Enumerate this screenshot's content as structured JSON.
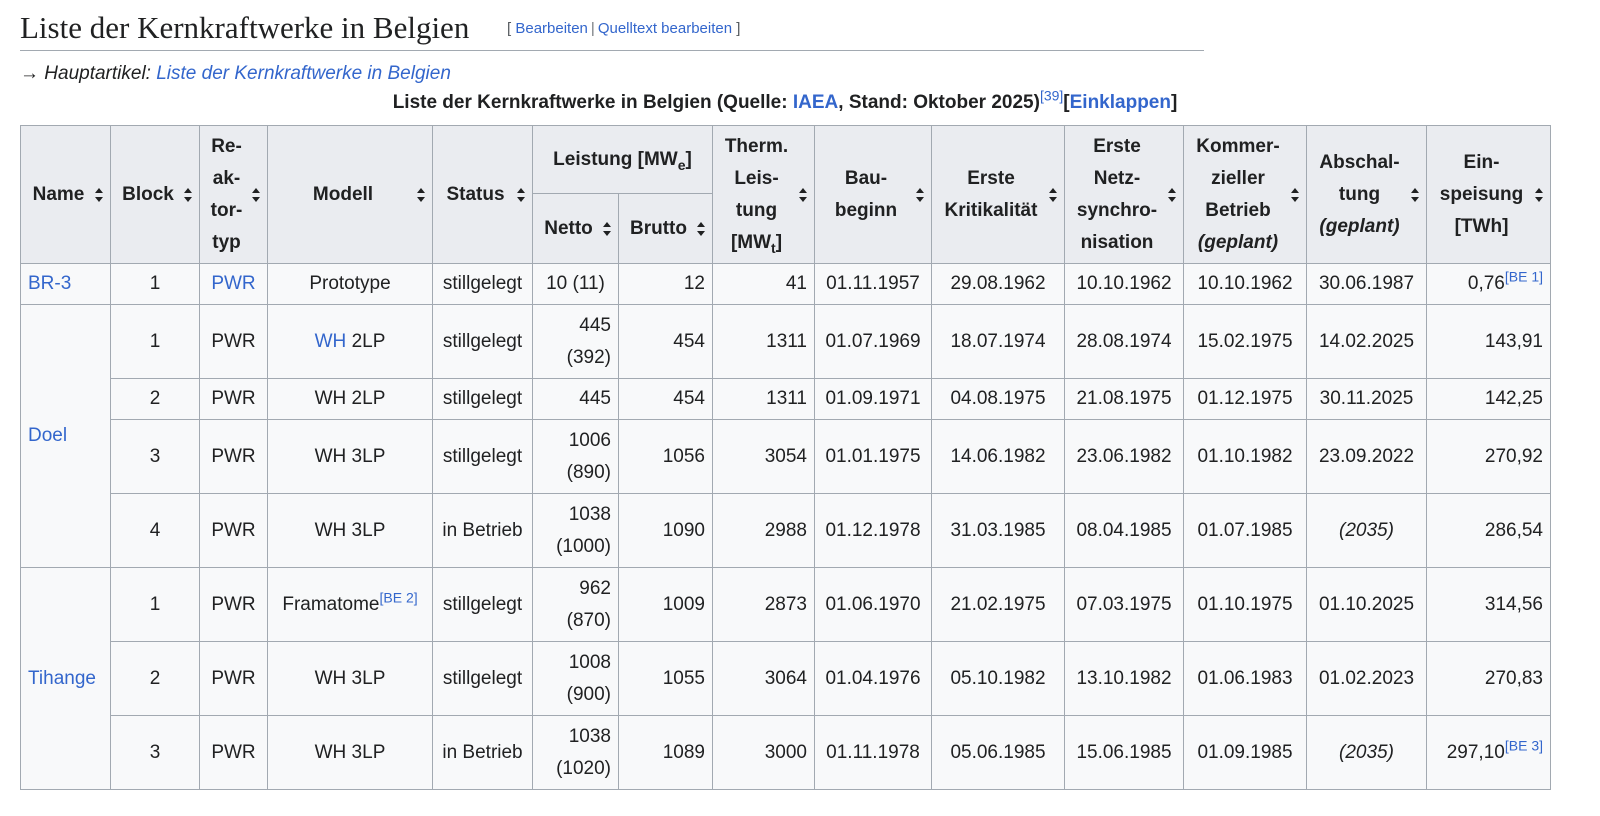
{
  "heading": {
    "title": "Liste der Kernkraftwerke in Belgien",
    "edit_open": "[",
    "edit": "Bearbeiten",
    "edit_sep": "|",
    "edit_source": "Quelltext bearbeiten",
    "edit_close": "]"
  },
  "hatnote": {
    "arrow": "→",
    "prefix": "Hauptartikel:",
    "link": "Liste der Kernkraftwerke in Belgien"
  },
  "caption": {
    "pre": "Liste der Kernkraftwerke in Belgien (Quelle: ",
    "link": "IAEA",
    "post": ", Stand: Oktober 2025)",
    "ref": "[39]",
    "collapse_open": "[",
    "collapse": "Einklappen",
    "collapse_close": "]"
  },
  "columns": {
    "name": "Name",
    "block": "Block",
    "reactor": "Re-ak-tor-typ",
    "model": "Modell",
    "status": "Status",
    "power_pre": "Leistung [MW",
    "power_sub": "e",
    "power_post": "]",
    "net": "Netto",
    "gross": "Brutto",
    "thermal_pre": "Therm. Leis-tung [MW",
    "thermal_sub": "t",
    "thermal_post": "]",
    "construction": "Bau-beginn",
    "criticality": "Erste Kritikalität",
    "grid": "Erste Netz-synchro-nisation",
    "commercial": "Kommer-zieller Betrieb",
    "commercial_note": "(geplant)",
    "shutdown": "Abschal-tung",
    "shutdown_note": "(geplant)",
    "feed": "Ein-speisung [TWh]"
  },
  "plants": {
    "br3": "BR-3",
    "doel": "Doel",
    "tihange": "Tihange"
  },
  "rows": [
    {
      "block": "1",
      "type": "PWR",
      "model": "Prototype",
      "status": "stillgelegt",
      "net": "10 (11)",
      "gross": "12",
      "thermal": "41",
      "construction": "01.11.1957",
      "criticality": "29.08.1962",
      "grid": "10.10.1962",
      "commercial": "10.10.1962",
      "shutdown": "30.06.1987",
      "feed": "0,76",
      "feed_ref": "[BE 1]"
    },
    {
      "block": "1",
      "type": "PWR",
      "model_link": "WH",
      "model": "2LP",
      "status": "stillgelegt",
      "net": "445 (392)",
      "gross": "454",
      "thermal": "1311",
      "construction": "01.07.1969",
      "criticality": "18.07.1974",
      "grid": "28.08.1974",
      "commercial": "15.02.1975",
      "shutdown": "14.02.2025",
      "feed": "143,91"
    },
    {
      "block": "2",
      "type": "PWR",
      "model": "WH 2LP",
      "status": "stillgelegt",
      "net": "445",
      "gross": "454",
      "thermal": "1311",
      "construction": "01.09.1971",
      "criticality": "04.08.1975",
      "grid": "21.08.1975",
      "commercial": "01.12.1975",
      "shutdown": "30.11.2025",
      "feed": "142,25"
    },
    {
      "block": "3",
      "type": "PWR",
      "model": "WH 3LP",
      "status": "stillgelegt",
      "net": "1006 (890)",
      "gross": "1056",
      "thermal": "3054",
      "construction": "01.01.1975",
      "criticality": "14.06.1982",
      "grid": "23.06.1982",
      "commercial": "01.10.1982",
      "shutdown": "23.09.2022",
      "feed": "270,92"
    },
    {
      "block": "4",
      "type": "PWR",
      "model": "WH 3LP",
      "status": "in Betrieb",
      "net": "1038 (1000)",
      "gross": "1090",
      "thermal": "2988",
      "construction": "01.12.1978",
      "criticality": "31.03.1985",
      "grid": "08.04.1985",
      "commercial": "01.07.1985",
      "shutdown": "(2035)",
      "feed": "286,54"
    },
    {
      "block": "1",
      "type": "PWR",
      "model": "Framatome",
      "model_ref": "[BE 2]",
      "status": "stillgelegt",
      "net": "962 (870)",
      "gross": "1009",
      "thermal": "2873",
      "construction": "01.06.1970",
      "criticality": "21.02.1975",
      "grid": "07.03.1975",
      "commercial": "01.10.1975",
      "shutdown": "01.10.2025",
      "feed": "314,56"
    },
    {
      "block": "2",
      "type": "PWR",
      "model": "WH 3LP",
      "status": "stillgelegt",
      "net": "1008 (900)",
      "gross": "1055",
      "thermal": "3064",
      "construction": "01.04.1976",
      "criticality": "05.10.1982",
      "grid": "13.10.1982",
      "commercial": "01.06.1983",
      "shutdown": "01.02.2023",
      "feed": "270,83"
    },
    {
      "block": "3",
      "type": "PWR",
      "model": "WH 3LP",
      "status": "in Betrieb",
      "net": "1038 (1020)",
      "gross": "1089",
      "thermal": "3000",
      "construction": "01.11.1978",
      "criticality": "05.06.1985",
      "grid": "15.06.1985",
      "commercial": "01.09.1985",
      "shutdown": "(2035)",
      "feed": "297,10",
      "feed_ref": "[BE 3]"
    }
  ]
}
